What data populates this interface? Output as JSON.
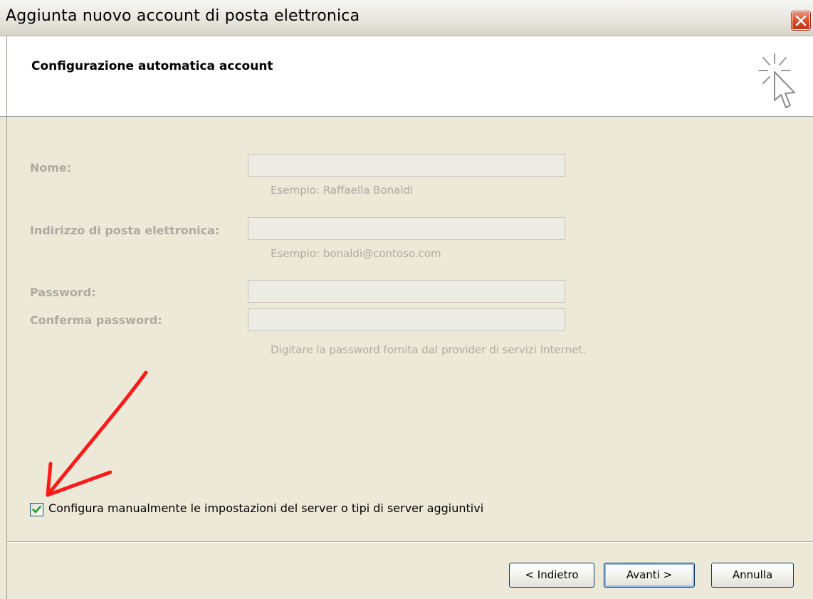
{
  "window": {
    "title": "Aggiunta nuovo account di posta elettronica"
  },
  "header": {
    "title": "Configurazione automatica account"
  },
  "form": {
    "name_label": "Nome:",
    "name_value": "",
    "name_hint": "Esempio: Raffaella Bonaldi",
    "email_label": "Indirizzo di posta elettronica:",
    "email_value": "",
    "email_hint": "Esempio: bonaldi@contoso.com",
    "password_label": "Password:",
    "password_value": "",
    "confirm_label": "Conferma password:",
    "confirm_value": "",
    "password_hint": "Digitare la password fornita dal provider di servizi Internet.",
    "manual_config_label": "Configura manualmente le impostazioni del server o tipi di server aggiuntivi",
    "manual_config_checked": true
  },
  "buttons": {
    "back": "< Indietro",
    "next": "Avanti >",
    "cancel": "Annulla"
  },
  "colors": {
    "annotation_arrow": "#ff0000",
    "checkmark": "#21a121",
    "disabled_text": "#acaaa2"
  }
}
